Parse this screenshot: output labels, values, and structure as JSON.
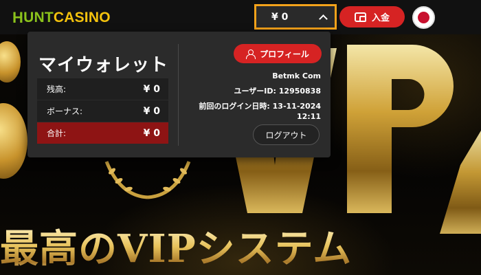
{
  "header": {
    "logo_mark": "H",
    "logo_text_1": "UNT",
    "logo_text_2": "CASINO",
    "balance": "¥ 0",
    "deposit_label": "入金",
    "language": "Japan"
  },
  "wallet": {
    "title": "マイウォレット",
    "rows": [
      {
        "label": "残高:",
        "value": "¥ 0"
      },
      {
        "label": "ボーナス:",
        "value": "¥ 0"
      },
      {
        "label": "合計:",
        "value": "¥ 0"
      }
    ],
    "profile_label": "プロフィール",
    "username": "Betmk Com",
    "user_id": "ユーザーID: 12950838",
    "last_login_label": "前回のログイン日時: 13-11-2024",
    "last_login_time": "12:11",
    "logout_label": "ログアウト"
  },
  "banner": {
    "headline": "最高のVIPシステム"
  },
  "colors": {
    "accent_red": "#d62323",
    "highlight_orange": "#f5a31a",
    "logo_green": "#8bc21c",
    "logo_yellow": "#f4c20d",
    "gold": "#e7c25b"
  }
}
